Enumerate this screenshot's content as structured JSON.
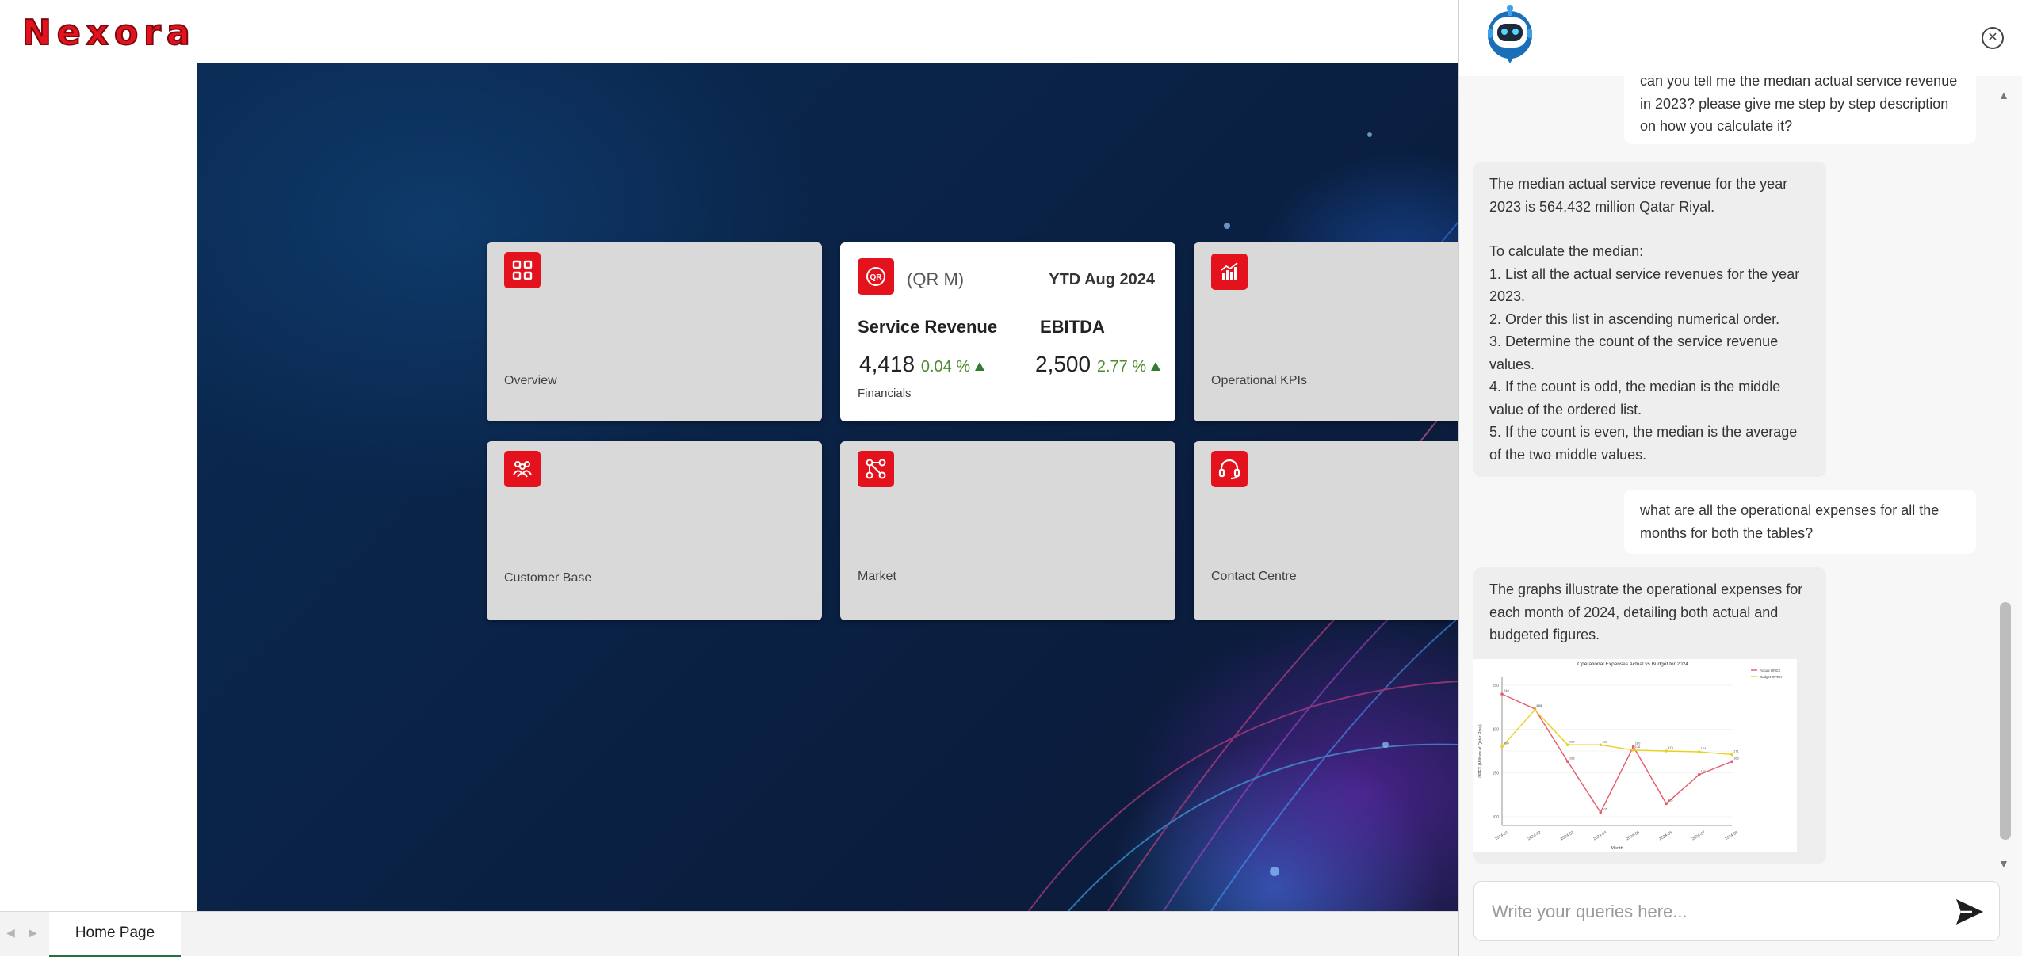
{
  "app": {
    "logo": "Nexora"
  },
  "cards": {
    "overview": {
      "label": "Overview"
    },
    "financials": {
      "currency": "(QR M)",
      "period": "YTD Aug 2024",
      "metric1": {
        "name": "Service Revenue",
        "value": "4,418",
        "change": "0.04 %"
      },
      "metric2": {
        "name": "EBITDA",
        "value": "2,500",
        "change": "2.77 %"
      },
      "label": "Financials"
    },
    "operational": {
      "label": "Operational KPIs"
    },
    "customer": {
      "label": "Customer Base"
    },
    "market": {
      "label": "Market"
    },
    "contact": {
      "label": "Contact Centre"
    }
  },
  "tabbar": {
    "active_tab": "Home Page",
    "prev": "◀",
    "next": "▶"
  },
  "chat": {
    "messages": {
      "user1": "can you tell me the median actual service revenue in 2023? please give me step by step description on how you calculate it?",
      "bot1": {
        "intro": "The median actual service revenue for the year 2023 is 564.432 million Qatar Riyal.",
        "lead": "To calculate the median:",
        "steps": [
          "1. List all the actual service revenues for the year 2023.",
          "2. Order this list in ascending numerical order.",
          "3. Determine the count of the service revenue values.",
          "4. If the count is odd, the median is the middle value of the ordered list.",
          "5. If the count is even, the median is the average of the two middle values."
        ]
      },
      "user2": "what are all the operational expenses for all the months for both the tables?",
      "bot2": "The graphs illustrate the operational expenses for each month of 2024, detailing both actual and budgeted figures."
    },
    "composer": {
      "placeholder": "Write your queries here..."
    }
  },
  "chart_data": {
    "type": "line",
    "title": "Operational Expenses Actual vs Budget for 2024",
    "xlabel": "Month",
    "ylabel": "OPEX (Millions of Qatar Riyal)",
    "categories": [
      "2024-01",
      "2024-02",
      "2024-03",
      "2024-04",
      "2024-05",
      "2024-06",
      "2024-07",
      "2024-08"
    ],
    "series": [
      {
        "name": "Actual OPEX",
        "color": "#e8596b",
        "values": [
          240,
          223,
          163,
          105,
          180,
          115,
          148,
          163
        ]
      },
      {
        "name": "Budget OPEX",
        "color": "#e6d21e",
        "values": [
          180,
          222,
          182,
          182,
          176,
          175,
          174,
          171
        ]
      }
    ],
    "legend": "top-right",
    "grid": true
  }
}
